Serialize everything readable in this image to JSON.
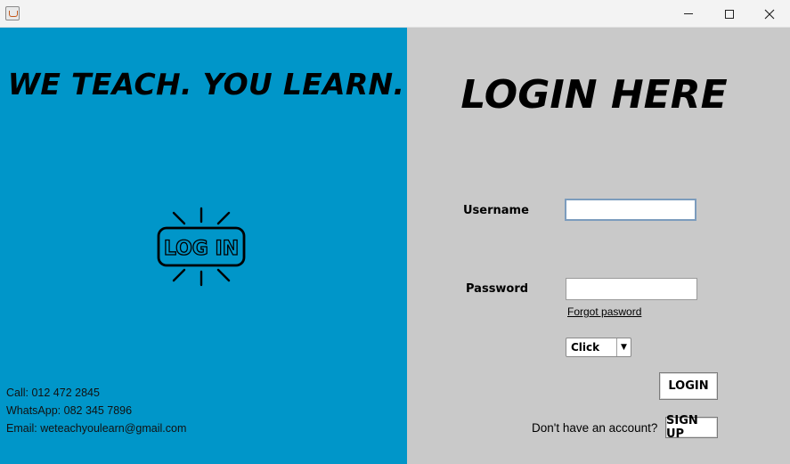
{
  "window": {
    "controls": {
      "minimize_icon": "minimize-icon",
      "maximize_icon": "maximize-icon",
      "close_icon": "close-icon"
    }
  },
  "left_panel": {
    "tagline": "WE TEACH. YOU LEARN.",
    "logo_text": "LOG IN",
    "contact": {
      "call": "Call: 012 472 2845",
      "whatsapp": "WhatsApp: 082 345 7896",
      "email": "Email: weteachyoulearn@gmail.com"
    },
    "background_color": "#0096c9"
  },
  "right_panel": {
    "title": "LOGIN HERE",
    "username_label": "Username",
    "username_value": "",
    "password_label": "Password",
    "password_value": "",
    "forgot_password": "Forgot pasword",
    "role_select": {
      "selected": "Click"
    },
    "login_button": "LOGIN",
    "no_account_text": "Don't have an account?",
    "signup_button": "SIGN UP",
    "background_color": "#c9c9c9"
  }
}
